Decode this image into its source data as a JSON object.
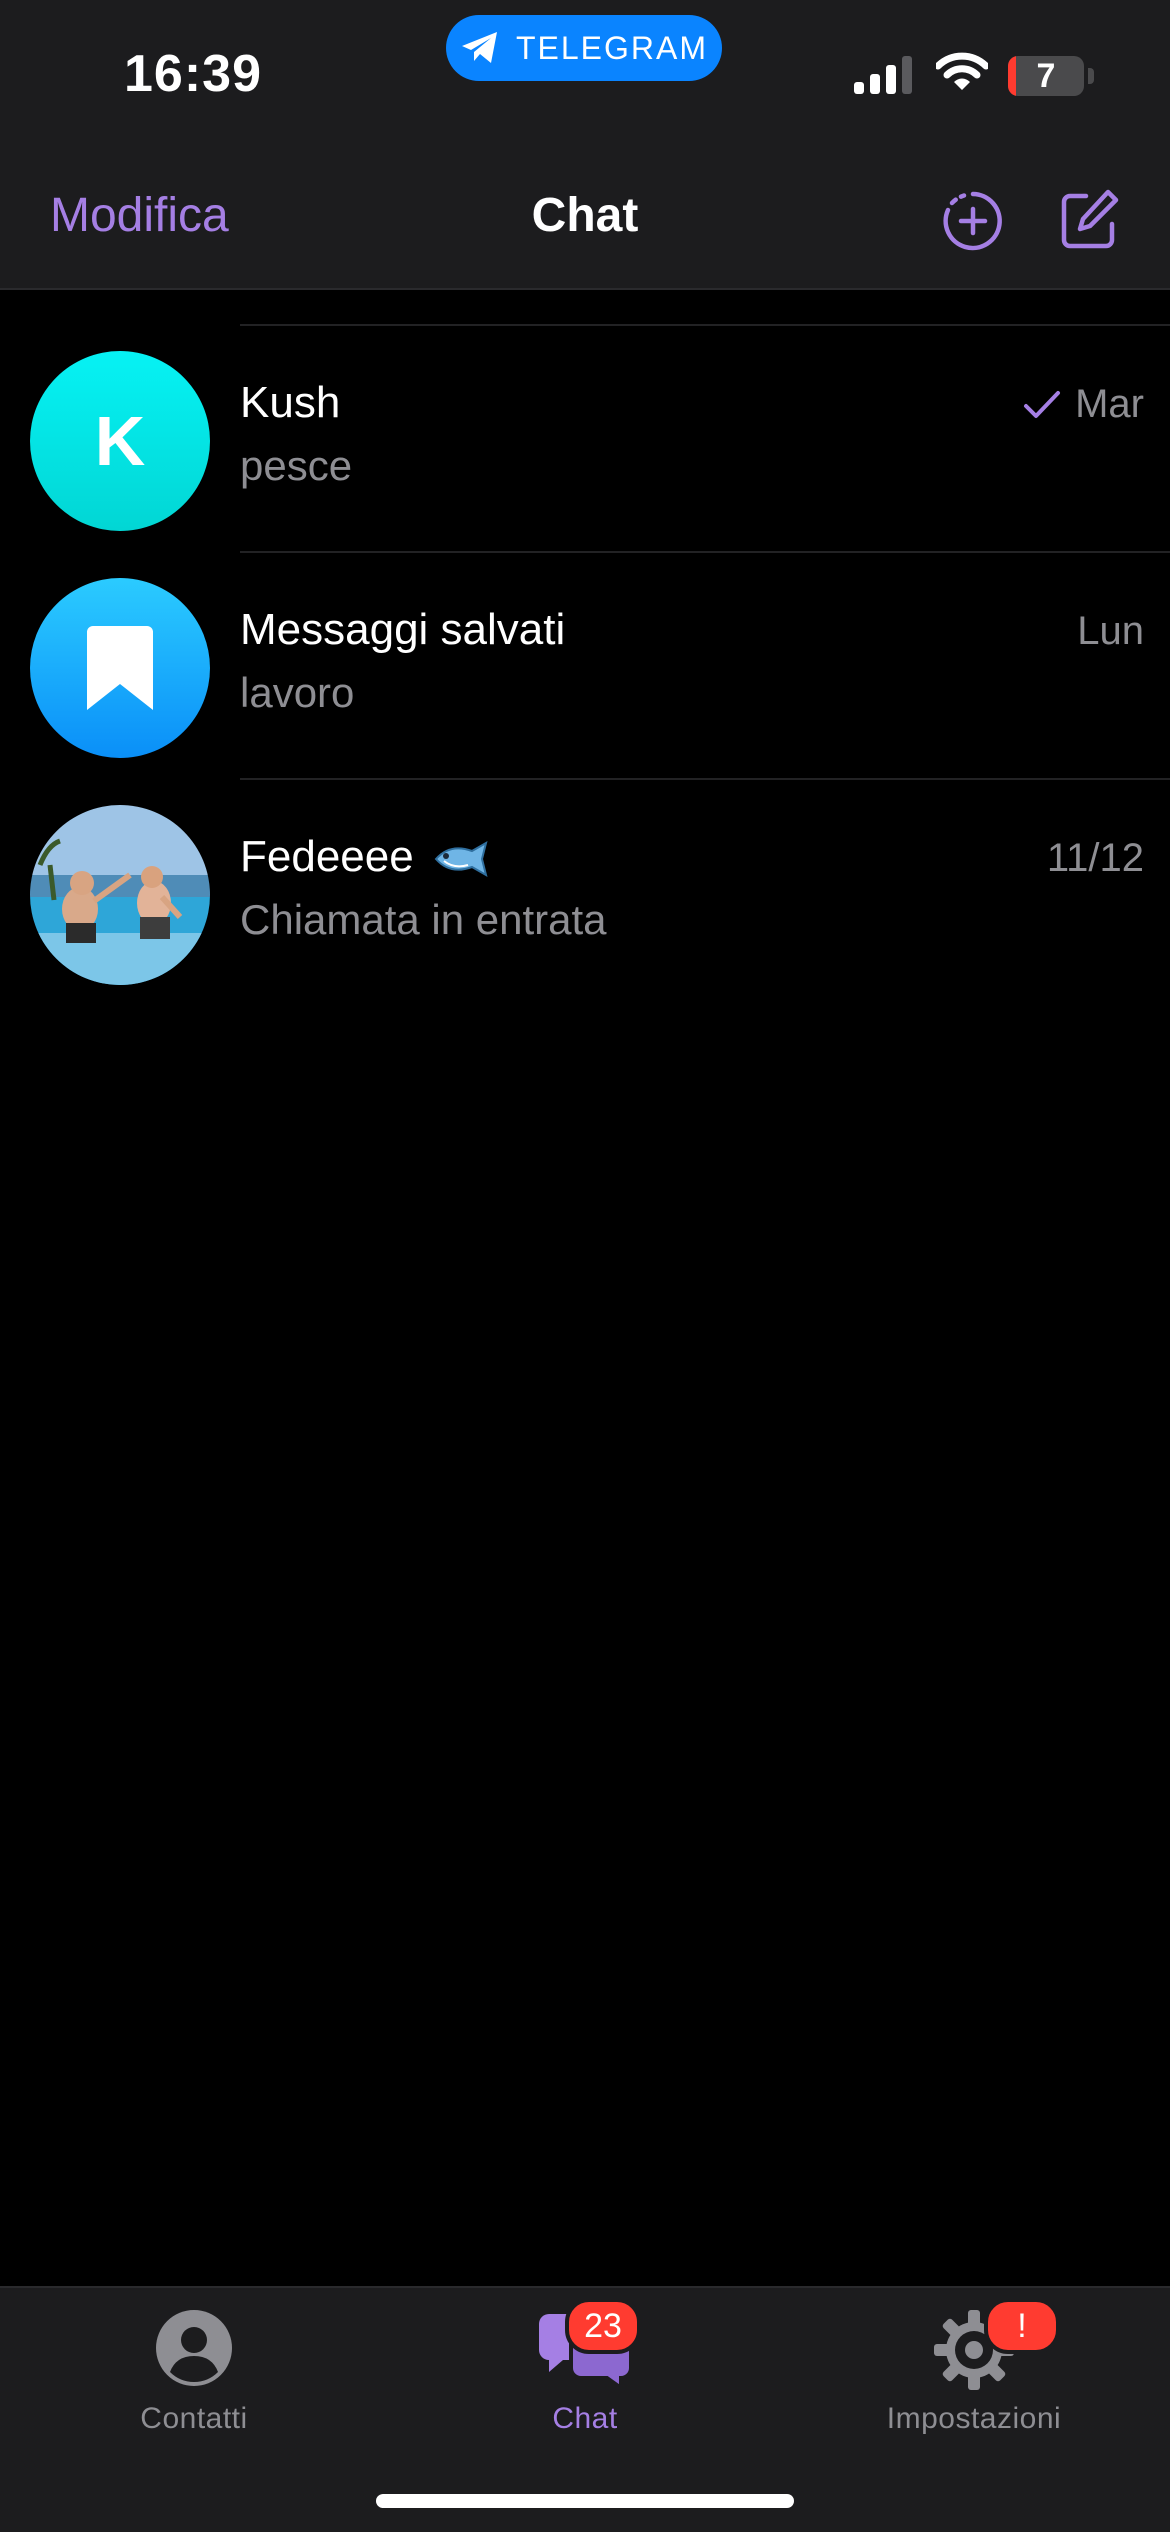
{
  "status_bar": {
    "time": "16:39",
    "app_pill": "TELEGRAM",
    "battery": "7"
  },
  "nav": {
    "edit_label": "Modifica",
    "title": "Chat"
  },
  "chats": [
    {
      "name": "Kush",
      "preview": "pesce",
      "date": "Mar",
      "read": true,
      "avatar_letter": "K",
      "avatar_color": "#06e6e8"
    },
    {
      "name": "Messaggi salvati",
      "preview": "lavoro",
      "date": "Lun",
      "avatar_icon": "bookmark-icon",
      "avatar_color": "#1aa8fb"
    },
    {
      "name": "Fedeeee",
      "name_emoji": "fish-icon",
      "preview": "Chiamata in entrata",
      "date": "11/12",
      "avatar_icon": "photo-avatar"
    }
  ],
  "tabbar": {
    "contacts_label": "Contatti",
    "chats_label": "Chat",
    "chats_badge": "23",
    "settings_label": "Impostazioni",
    "settings_badge": "!"
  },
  "colors": {
    "accent": "#a57fe4",
    "badge": "#ff3b30",
    "pill": "#0a84ff",
    "bar_background": "#1c1c1e"
  }
}
